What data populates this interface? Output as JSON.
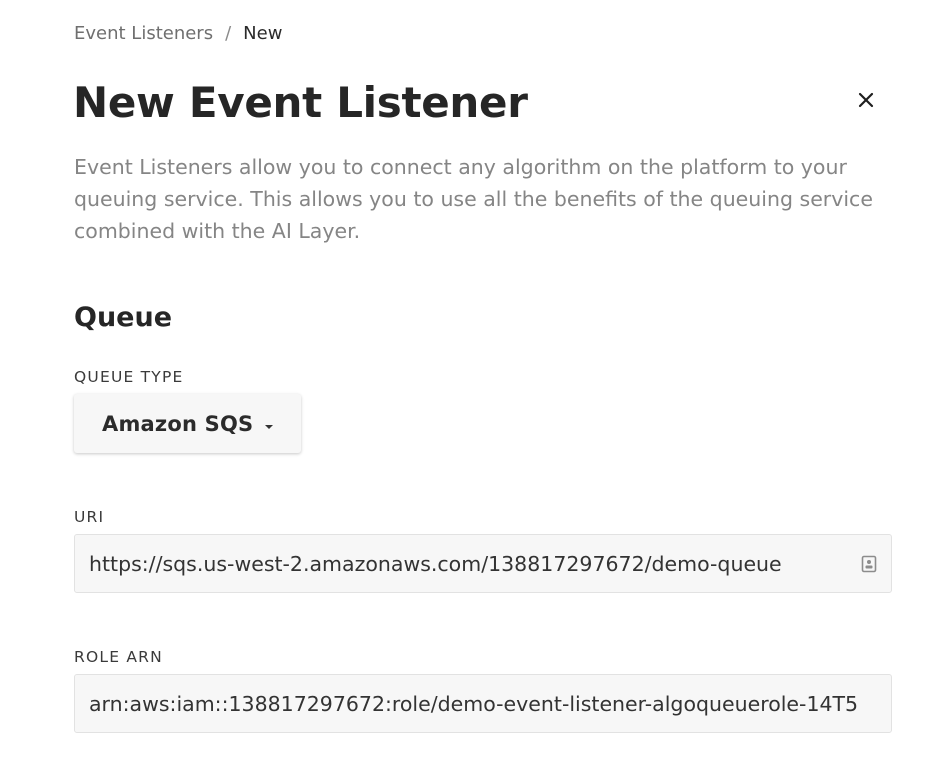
{
  "breadcrumb": {
    "parent": "Event Listeners",
    "separator": "/",
    "current": "New"
  },
  "header": {
    "title": "New Event Listener",
    "close_icon": "close-icon"
  },
  "description": "Event Listeners allow you to connect any algorithm on the platform to your queuing service. This allows you to use all the benefits of the queuing service combined with the AI Layer.",
  "queue_section": {
    "title": "Queue",
    "queue_type": {
      "label": "QUEUE TYPE",
      "selected": "Amazon SQS",
      "icon": "chevron-down-icon"
    },
    "uri": {
      "label": "URI",
      "value": "https://sqs.us-west-2.amazonaws.com/138817297672/demo-queue",
      "icon": "contact-card-icon"
    },
    "role_arn": {
      "label": "ROLE ARN",
      "value": "arn:aws:iam::138817297672:role/demo-event-listener-algoqueuerole-14T5"
    }
  },
  "colors": {
    "title": "#262626",
    "muted_text": "#858585",
    "field_background": "#f7f7f7",
    "field_border": "#e2e2e2"
  }
}
